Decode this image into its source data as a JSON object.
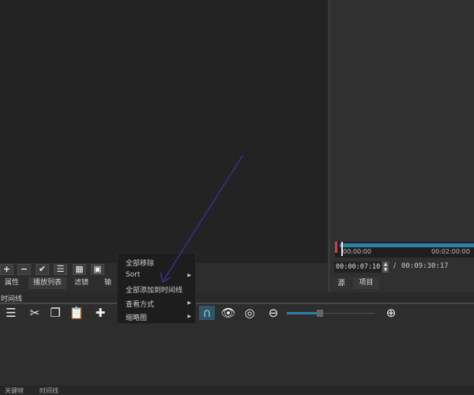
{
  "playlist_toolbar": {
    "add": "+",
    "remove": "−",
    "update": "✔",
    "list_view": "☰",
    "grid_view": "▦",
    "detail_view": "▣"
  },
  "panel_tabs": [
    "属性",
    "播放列表",
    "滤镜",
    "输"
  ],
  "timeline_title": "时间线",
  "context_menu": {
    "items": [
      {
        "label": "全部移除",
        "submenu": false
      },
      {
        "label": "Sort",
        "submenu": true
      },
      {
        "label": "全部添加到时间线",
        "submenu": false
      },
      {
        "label": "查看方式",
        "submenu": true
      },
      {
        "label": "缩略图",
        "submenu": true
      }
    ]
  },
  "player": {
    "ruler_start": "00:00:00",
    "ruler_mark": "00:02:00:00",
    "current_time": "00:00:07:10",
    "separator": "/",
    "total_time": "00:09:30:17",
    "tabs": [
      "源",
      "项目"
    ]
  },
  "zoom_level": 0.6,
  "bottom_tabs": [
    "关键帧",
    "时间线"
  ],
  "colors": {
    "accent": "#2d7fa8",
    "arrow": "#3a2f8f"
  }
}
